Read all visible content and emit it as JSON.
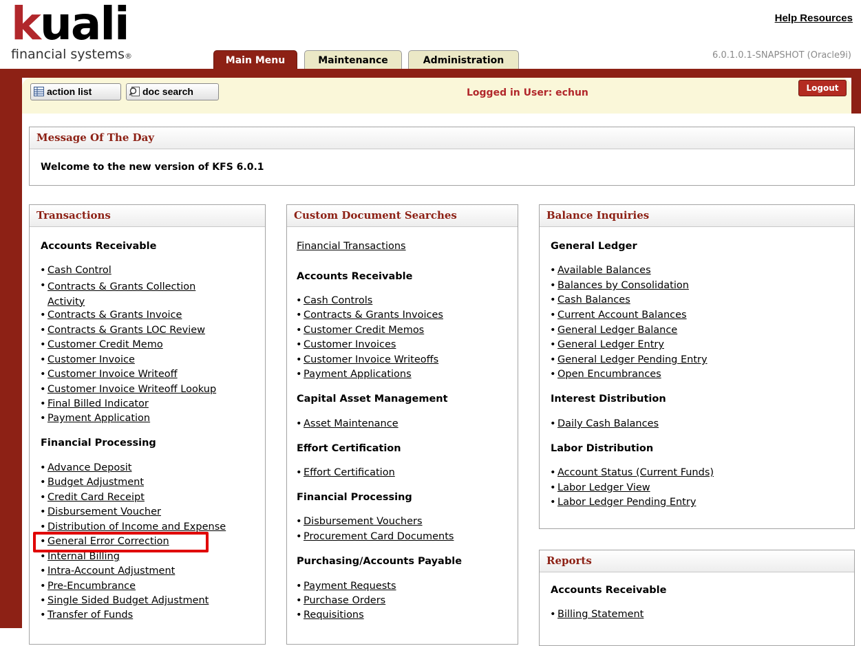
{
  "header": {
    "logo_mark": "kuali",
    "logo_sub": "financial systems",
    "logo_reg": "®",
    "help_link": "Help Resources",
    "version": "6.0.1.0.1-SNAPSHOT (Oracle9i)",
    "tabs": [
      {
        "label": "Main Menu",
        "active": true
      },
      {
        "label": "Maintenance",
        "active": false
      },
      {
        "label": "Administration",
        "active": false
      }
    ]
  },
  "toolbar": {
    "action_list": "action list",
    "doc_search": "doc search",
    "logged_in": "Logged in User: echun",
    "logout": "Logout"
  },
  "motd": {
    "title": "Message Of The Day",
    "text": "Welcome to the new version of KFS 6.0.1"
  },
  "transactions": {
    "title": "Transactions",
    "sections": [
      {
        "title": "Accounts Receivable",
        "items": [
          "Cash Control",
          "Contracts & Grants Collection Activity",
          "Contracts & Grants Invoice",
          "Contracts & Grants LOC Review",
          "Customer Credit Memo",
          "Customer Invoice",
          "Customer Invoice Writeoff",
          "Customer Invoice Writeoff Lookup",
          "Final Billed Indicator",
          "Payment Application"
        ]
      },
      {
        "title": "Financial Processing",
        "items": [
          "Advance Deposit",
          "Budget Adjustment",
          "Credit Card Receipt",
          "Disbursement Voucher",
          "Distribution of Income and Expense",
          "General Error Correction",
          "Internal Billing",
          "Intra-Account Adjustment",
          "Pre-Encumbrance",
          "Single Sided Budget Adjustment",
          "Transfer of Funds"
        ]
      }
    ]
  },
  "custom_searches": {
    "title": "Custom Document Searches",
    "top_link": "Financial Transactions",
    "sections": [
      {
        "title": "Accounts Receivable",
        "items": [
          "Cash Controls",
          "Contracts & Grants Invoices",
          "Customer Credit Memos",
          "Customer Invoices",
          "Customer Invoice Writeoffs",
          "Payment Applications"
        ]
      },
      {
        "title": "Capital Asset Management",
        "items": [
          "Asset Maintenance"
        ]
      },
      {
        "title": "Effort Certification",
        "items": [
          "Effort Certification"
        ]
      },
      {
        "title": "Financial Processing",
        "items": [
          "Disbursement Vouchers",
          "Procurement Card Documents"
        ]
      },
      {
        "title": "Purchasing/Accounts Payable",
        "items": [
          "Payment Requests",
          "Purchase Orders",
          "Requisitions"
        ]
      }
    ]
  },
  "balance_inquiries": {
    "title": "Balance Inquiries",
    "sections": [
      {
        "title": "General Ledger",
        "items": [
          "Available Balances",
          "Balances by Consolidation",
          "Cash Balances",
          "Current Account Balances",
          "General Ledger Balance",
          "General Ledger Entry",
          "General Ledger Pending Entry",
          "Open Encumbrances"
        ]
      },
      {
        "title": "Interest Distribution",
        "items": [
          "Daily Cash Balances"
        ]
      },
      {
        "title": "Labor Distribution",
        "items": [
          "Account Status (Current Funds)",
          "Labor Ledger View",
          "Labor Ledger Pending Entry"
        ]
      }
    ]
  },
  "reports": {
    "title": "Reports",
    "sections": [
      {
        "title": "Accounts Receivable",
        "items": [
          "Billing Statement"
        ]
      }
    ]
  },
  "colors": {
    "brand_red": "#8d2115",
    "accent_red": "#b1272b",
    "highlight": "#e00000"
  }
}
